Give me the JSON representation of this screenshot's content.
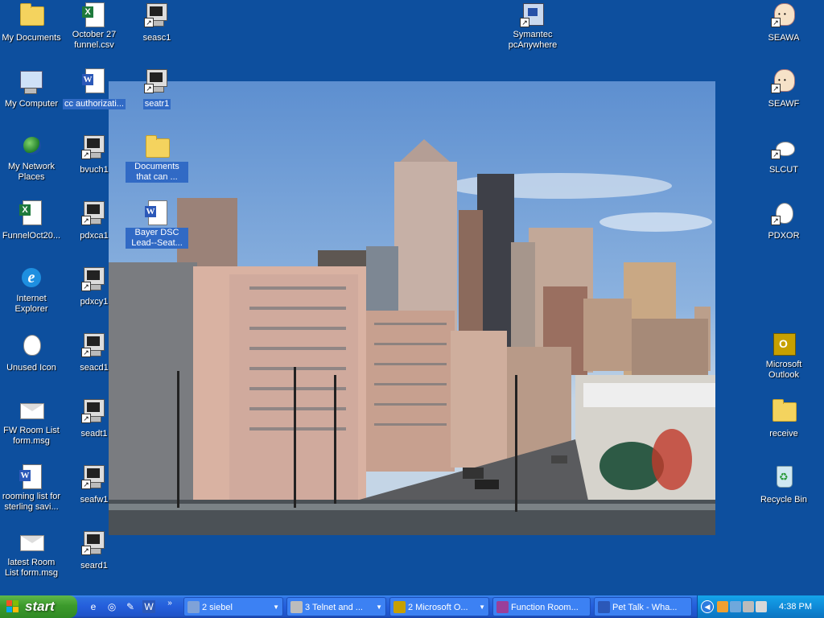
{
  "desktop": {
    "icons_col1": [
      {
        "label": "My Documents"
      },
      {
        "label": "My Computer"
      },
      {
        "label": "My Network Places"
      },
      {
        "label": "FunnelOct20..."
      },
      {
        "label": "Internet Explorer"
      },
      {
        "label": "Unused Icon"
      },
      {
        "label": "FW Room List form.msg"
      },
      {
        "label": "rooming list for sterling savi..."
      },
      {
        "label": "latest Room List form.msg"
      }
    ],
    "icons_col2": [
      {
        "label": "October 27 funnel.csv"
      },
      {
        "label": "cc authorizati..."
      },
      {
        "label": "bvuch1"
      },
      {
        "label": "pdxca1"
      },
      {
        "label": "pdxcy1"
      },
      {
        "label": "seacd1"
      },
      {
        "label": "seadt1"
      },
      {
        "label": "seafw1"
      },
      {
        "label": "seard1"
      }
    ],
    "icons_col3": [
      {
        "label": "seasc1"
      },
      {
        "label": "seatr1"
      },
      {
        "label": "Documents that can ..."
      },
      {
        "label": "Bayer DSC Lead--Seat..."
      }
    ],
    "icon_mid": {
      "label": "Symantec pcAnywhere"
    },
    "icons_right": [
      {
        "label": "SEAWA"
      },
      {
        "label": "SEAWF"
      },
      {
        "label": "SLCUT"
      },
      {
        "label": "PDXOR"
      },
      {
        "label": "Microsoft Outlook"
      },
      {
        "label": "receive"
      },
      {
        "label": "Recycle Bin"
      }
    ]
  },
  "taskbar": {
    "start_label": "start",
    "tasks": [
      {
        "label": "2 siebel"
      },
      {
        "label": "3 Telnet and ..."
      },
      {
        "label": "2 Microsoft O..."
      },
      {
        "label": "Function Room..."
      },
      {
        "label": "Pet Talk - Wha..."
      }
    ],
    "clock": "4:38 PM"
  }
}
